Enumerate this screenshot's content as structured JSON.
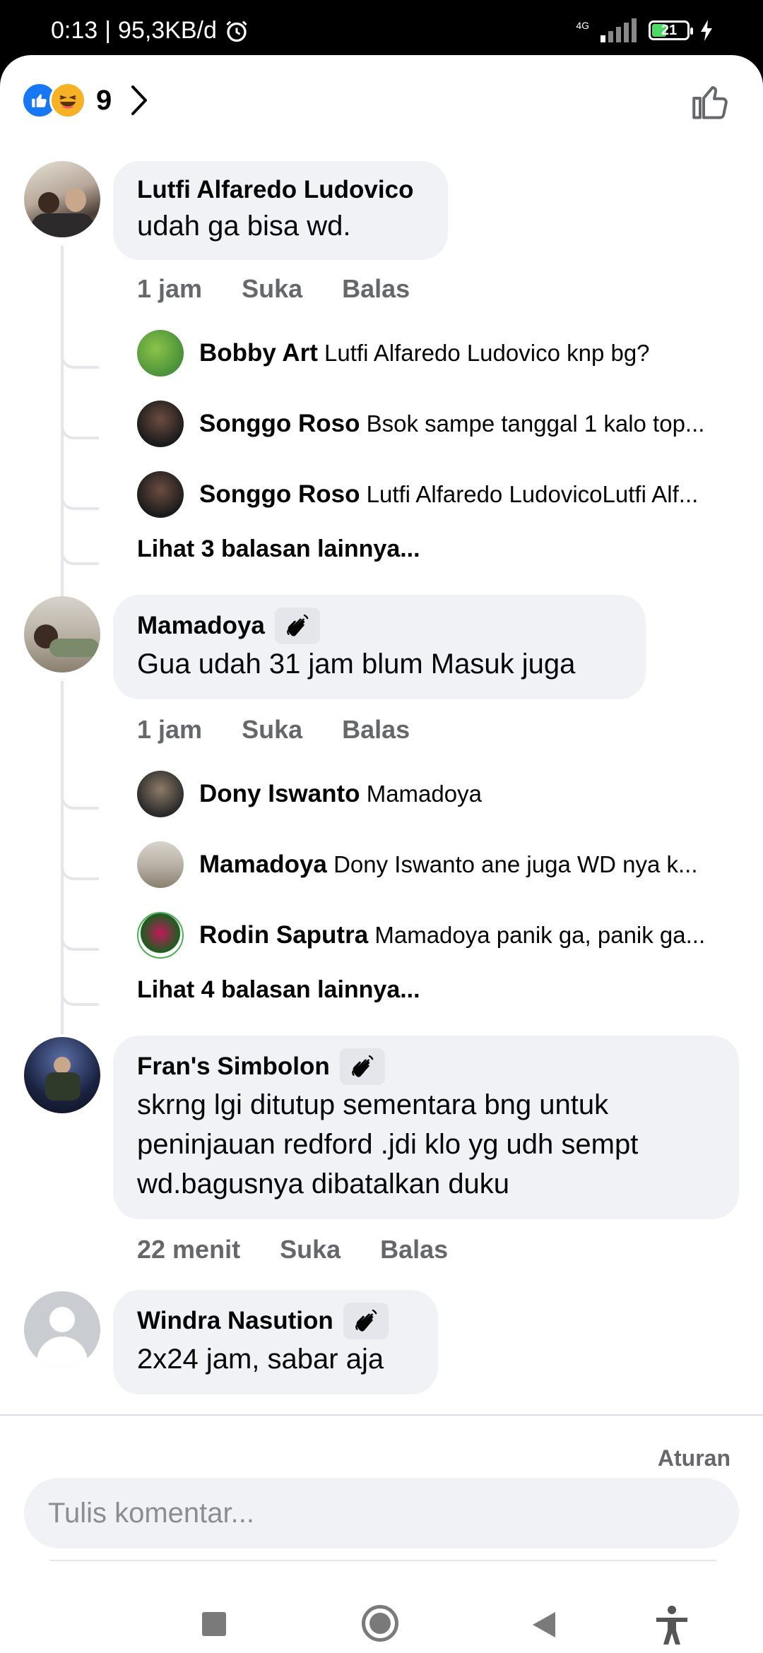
{
  "status_bar": {
    "time": "0:13",
    "separator": "|",
    "speed": "95,3KB/d",
    "network": "4G",
    "battery": "21"
  },
  "reactions": {
    "count": "9",
    "icons": [
      "like-icon",
      "haha-icon"
    ]
  },
  "comments": [
    {
      "name": "Lutfi Alfaredo Ludovico",
      "text": "udah ga bisa wd.",
      "time": "1 jam",
      "like": "Suka",
      "reply": "Balas",
      "replies": [
        {
          "name": "Bobby Art",
          "text": "Lutfi Alfaredo Ludovico knp bg?"
        },
        {
          "name": "Songgo Roso",
          "text": "Bsok sampe tanggal 1 kalo top..."
        },
        {
          "name": "Songgo Roso",
          "text": "Lutfi Alfaredo LudovicoLutfi Alf..."
        }
      ],
      "more": "Lihat 3 balasan lainnya..."
    },
    {
      "name": "Mamadoya",
      "text": "Gua udah 31 jam blum Masuk juga",
      "time": "1 jam",
      "like": "Suka",
      "reply": "Balas",
      "replies": [
        {
          "name": "Dony Iswanto",
          "text": "Mamadoya"
        },
        {
          "name": "Mamadoya",
          "text": "Dony Iswanto ane juga WD nya k..."
        },
        {
          "name": "Rodin Saputra",
          "text": "Mamadoya panik ga, panik ga..."
        }
      ],
      "more": "Lihat 4 balasan lainnya..."
    },
    {
      "name": "Fran's Simbolon",
      "text": "skrng lgi ditutup sementara bng untuk peninjauan redford .jdi klo yg udh sempt wd.bagusnya dibatalkan duku",
      "time": "22 menit",
      "like": "Suka",
      "reply": "Balas"
    },
    {
      "name": "Windra Nasution",
      "text": "2x24 jam, sabar aja"
    }
  ],
  "footer": {
    "rules": "Aturan",
    "comment_placeholder": "Tulis komentar..."
  },
  "colors": {
    "bubble": "#f0f2f5",
    "meta_text": "#65676b",
    "like_blue": "#1877f2"
  }
}
